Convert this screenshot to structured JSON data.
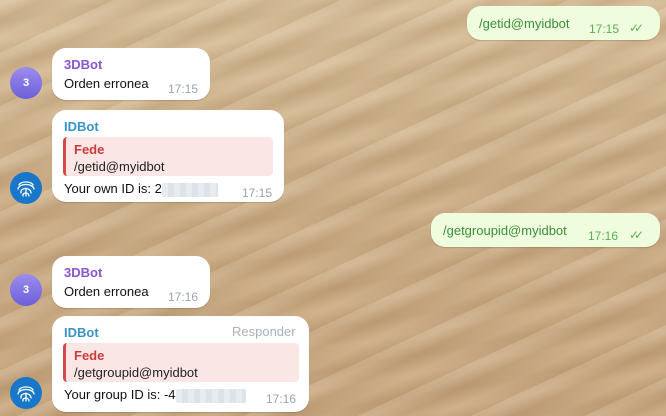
{
  "messages": {
    "out1": {
      "text": "/getid@myidbot",
      "time": "17:15"
    },
    "m1": {
      "avatar_initial": "3",
      "sender": "3DBot",
      "text": "Orden erronea",
      "time": "17:15"
    },
    "m2": {
      "sender": "IDBot",
      "reply_name": "Fede",
      "reply_text": "/getid@myidbot",
      "text_prefix": "Your own ID is: ",
      "text_visible": "2",
      "time": "17:15"
    },
    "out2": {
      "text": "/getgroupid@myidbot",
      "time": "17:16"
    },
    "m3": {
      "avatar_initial": "3",
      "sender": "3DBot",
      "text": "Orden erronea",
      "time": "17:16"
    },
    "m4": {
      "sender": "IDBot",
      "action": "Responder",
      "reply_name": "Fede",
      "reply_text": "/getgroupid@myidbot",
      "text_prefix": "Your group ID is: ",
      "text_visible": "-4",
      "time": "17:16"
    }
  },
  "icons": {
    "read_receipt": "double-check-icon",
    "bot_avatar": "fingerprint-icon"
  },
  "colors": {
    "outgoing_bubble": "#effdde",
    "incoming_bubble": "#ffffff",
    "sender_3dbot": "#8a56cf",
    "sender_idbot": "#3a93c7",
    "reply_accent": "#d24a4a"
  }
}
